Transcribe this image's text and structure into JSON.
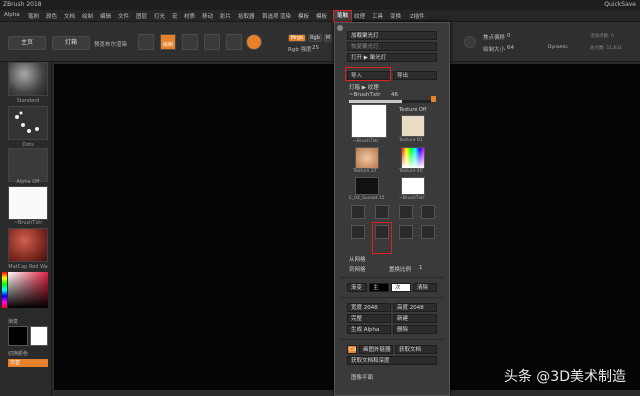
{
  "titlebar": {
    "title": "ZBrush 2018",
    "quicksave": "QuickSave"
  },
  "menu": [
    "Alpha",
    "笔刷",
    "颜色",
    "文档",
    "绘制",
    "编辑",
    "文件",
    "图层",
    "灯光",
    "宏",
    "材质",
    "移动",
    "影片",
    "拾取器",
    "首选项",
    "渲染",
    "模板",
    "笔触",
    "纹理",
    "工具",
    "变换",
    "Z插件",
    "Z脚本"
  ],
  "toolbar": {
    "home": "主页",
    "lightbox": "灯箱",
    "render_label": "预览布尔渲染",
    "draw": "绘制",
    "mrgb": "Mrgb",
    "rgb": "Rgb",
    "m": "M",
    "rgb_intensity_label": "Rgb 强度",
    "rgb_intensity": "25",
    "focal_shift_label": "焦点偏移",
    "focal_shift": "0",
    "draw_size_label": "绘制大小",
    "draw_size": "64",
    "dynamic": "Dynamic",
    "active_points": "活动点数: 0",
    "total_points": "总点数: 11,631"
  },
  "left_panel": {
    "items": [
      "Standard",
      "Dots",
      "Alpha Off",
      "~BrushTxtr",
      "MatCap Red Wa"
    ],
    "gradient_label": "渐变",
    "switch_color": "切换颜色",
    "alternate": "交替"
  },
  "texture_panel": {
    "import_spotlight": "加载聚光灯",
    "restore_spotlight": "恢复聚光灯",
    "open_spotlight": "打开 ▶ 聚光灯",
    "import": "导入",
    "export": "导出",
    "lightbox_texture": "灯箱 ▶ 纹理",
    "brushtxtr_label": "~BrushTxtr",
    "brushtxtr_value": "46",
    "thumb_brushtxtr": "~BrushTxtr",
    "texture_off": "Texture Off",
    "texture_01": "Texture 01",
    "texture_27": "Texture 27",
    "texture_40": "Texture 40",
    "env_label": "E_04_Sunset.15",
    "brushtxtr2": "~BrushTxtr",
    "icon_labels": [
      "翻转",
      "旋转",
      "反转",
      "灰度",
      "克隆",
      "新建",
      "裁剪",
      "填充"
    ],
    "from_brush": "从网格",
    "to_mesh": "到网格",
    "adjust_ratio_label": "置换比例",
    "adjust_ratio": "1",
    "gradient": "渐变",
    "main": "主",
    "sec": "次",
    "clear": "清除",
    "width_label": "宽度",
    "width": "2048",
    "height_label": "高度",
    "height": "2048",
    "full": "完整",
    "new": "新建",
    "make_alpha": "生成 Alpha",
    "remove": "删除",
    "cd": "Cd",
    "image_editor": "画图外链器",
    "get_doc": "获取文档",
    "get_doc_depth": "获取文档和深度",
    "image_plane": "图像平面"
  },
  "watermark": "头条 @3D美术制造"
}
